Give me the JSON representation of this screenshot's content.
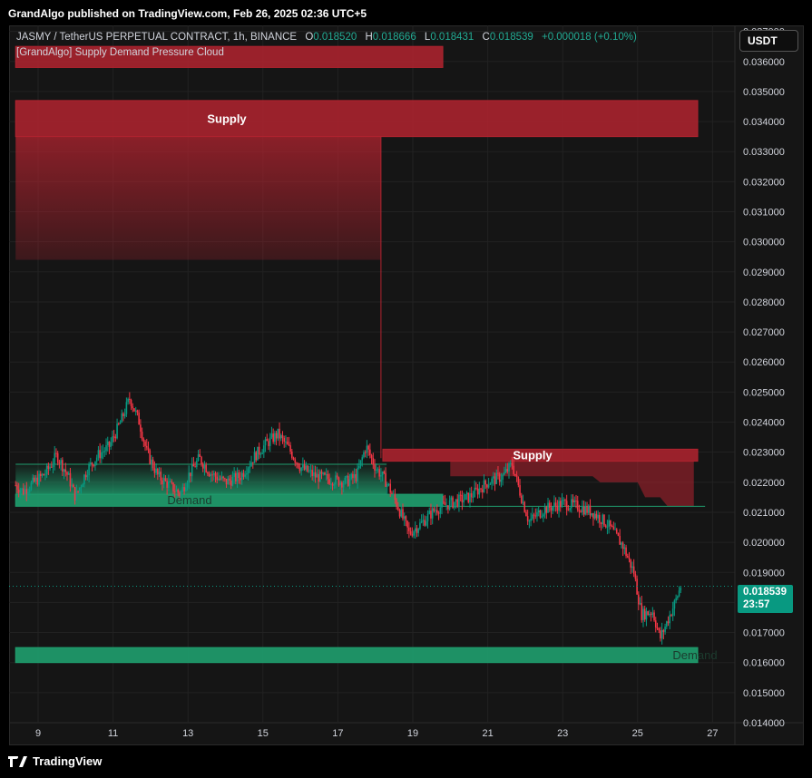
{
  "header": {
    "publish_text": "GrandAlgo published on TradingView.com, Feb 26, 2025 02:36 UTC+5"
  },
  "legend": {
    "symbol": "JASMY / TetherUS PERPETUAL CONTRACT, 1h, BINANCE",
    "o_key": "O",
    "o_val": "0.018520",
    "h_key": "H",
    "h_val": "0.018666",
    "l_key": "L",
    "l_val": "0.018431",
    "c_key": "C",
    "c_val": "0.018539",
    "change": "+0.000018 (+0.10%)",
    "indicator": "[GrandAlgo] Supply Demand Pressure Cloud"
  },
  "currency_button": "USDT",
  "last_price": {
    "price": "0.018539",
    "countdown": "23:57"
  },
  "footer": {
    "brand": "TradingView"
  },
  "colors": {
    "up": "#089981",
    "down": "#f23645",
    "supply_zone": "#b2232f",
    "demand_zone": "#1f9e6e"
  },
  "chart_data": {
    "type": "candlestick",
    "y_ticks": [
      "0.014000",
      "0.015000",
      "0.016000",
      "0.017000",
      "0.018000",
      "0.019000",
      "0.020000",
      "0.021000",
      "0.022000",
      "0.023000",
      "0.024000",
      "0.025000",
      "0.026000",
      "0.027000",
      "0.028000",
      "0.029000",
      "0.030000",
      "0.031000",
      "0.032000",
      "0.033000",
      "0.034000",
      "0.035000",
      "0.036000",
      "0.037000"
    ],
    "x_ticks": [
      "9",
      "11",
      "13",
      "15",
      "17",
      "19",
      "21",
      "23",
      "25",
      "27"
    ],
    "ylim": [
      0.014,
      0.0372
    ],
    "zone_labels": {
      "supply_top": "Supply",
      "supply_mid": "Supply",
      "demand_left": "Demand",
      "demand_bottom": "Demand"
    },
    "zones": [
      {
        "kind": "supply",
        "x0": 8.4,
        "x1": 19.8,
        "ybot": 0.0358,
        "ytop": 0.0365
      },
      {
        "kind": "supply",
        "x0": 8.4,
        "x1": 26.8,
        "ybot": 0.0335,
        "ytop": 0.0347,
        "label": "supply_top"
      },
      {
        "kind": "supply",
        "x0": 18.2,
        "x1": 26.8,
        "ybot": 0.0227,
        "ytop": 0.0231,
        "label": "supply_mid"
      },
      {
        "kind": "demand",
        "x0": 8.4,
        "x1": 19.8,
        "ybot": 0.0212,
        "ytop": 0.0216,
        "label": "demand_left"
      },
      {
        "kind": "demand",
        "x0": 8.4,
        "x1": 26.8,
        "ybot": 0.016,
        "ytop": 0.0165,
        "label": "demand_bottom"
      }
    ],
    "last_close": 0.018539,
    "price_path": [
      [
        8.4,
        0.0219
      ],
      [
        8.6,
        0.0217
      ],
      [
        8.9,
        0.022
      ],
      [
        9.2,
        0.0223
      ],
      [
        9.5,
        0.0229
      ],
      [
        9.8,
        0.0222
      ],
      [
        10.0,
        0.0215
      ],
      [
        10.3,
        0.0224
      ],
      [
        10.6,
        0.0229
      ],
      [
        10.9,
        0.0232
      ],
      [
        11.2,
        0.024
      ],
      [
        11.45,
        0.0248
      ],
      [
        11.7,
        0.024
      ],
      [
        11.9,
        0.023
      ],
      [
        12.2,
        0.0222
      ],
      [
        12.5,
        0.0219
      ],
      [
        12.8,
        0.0216
      ],
      [
        13.0,
        0.0222
      ],
      [
        13.3,
        0.0228
      ],
      [
        13.6,
        0.0223
      ],
      [
        14.0,
        0.022
      ],
      [
        14.4,
        0.0222
      ],
      [
        14.8,
        0.0229
      ],
      [
        15.1,
        0.0233
      ],
      [
        15.4,
        0.0236
      ],
      [
        15.7,
        0.0231
      ],
      [
        16.0,
        0.0225
      ],
      [
        16.4,
        0.0222
      ],
      [
        16.8,
        0.0221
      ],
      [
        17.2,
        0.022
      ],
      [
        17.5,
        0.0222
      ],
      [
        17.75,
        0.0232
      ],
      [
        18.0,
        0.0225
      ],
      [
        18.3,
        0.022
      ],
      [
        18.6,
        0.0212
      ],
      [
        18.9,
        0.0203
      ],
      [
        19.2,
        0.0206
      ],
      [
        19.6,
        0.0211
      ],
      [
        20.0,
        0.0213
      ],
      [
        20.5,
        0.0215
      ],
      [
        21.0,
        0.022
      ],
      [
        21.4,
        0.0222
      ],
      [
        21.65,
        0.0226
      ],
      [
        21.9,
        0.0215
      ],
      [
        22.1,
        0.0207
      ],
      [
        22.5,
        0.0211
      ],
      [
        23.0,
        0.0213
      ],
      [
        23.4,
        0.0212
      ],
      [
        23.8,
        0.021
      ],
      [
        24.2,
        0.0206
      ],
      [
        24.6,
        0.0199
      ],
      [
        24.9,
        0.019
      ],
      [
        25.1,
        0.0176
      ],
      [
        25.4,
        0.0177
      ],
      [
        25.6,
        0.0168
      ],
      [
        25.8,
        0.0174
      ],
      [
        26.0,
        0.018
      ],
      [
        26.15,
        0.01854
      ]
    ]
  }
}
